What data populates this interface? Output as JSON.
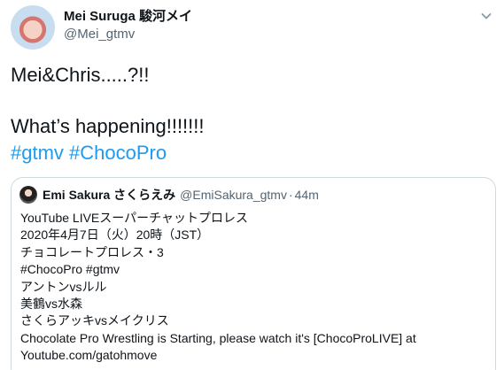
{
  "author": {
    "display_name": "Mei Suruga 駿河メイ",
    "handle": "@Mei_gtmv"
  },
  "tweet": {
    "text": "Mei&Chris.....?!!\n\nWhat’s happening!!!!!!!",
    "hashtags": [
      "#gtmv",
      "#ChocoPro"
    ]
  },
  "quote": {
    "display_name": "Emi Sakura さくらえみ",
    "handle": "@EmiSakura_gtmv",
    "separator": "·",
    "time": "44m",
    "lines": [
      "YouTube LIVEスーパーチャットプロレス",
      "2020年4月7日（火）20時（JST）",
      "チョコレートプロレス・3",
      "#ChocoPro #gtmv",
      "アントンvsルル",
      "美鶴vs水森",
      "さくらアッキvsメイクリス",
      "Chocolate Pro Wrestling is Starting, please watch it's [ChocoProLIVE] at",
      "Youtube.com/gatohmove"
    ]
  },
  "icons": {
    "menu": "chevron-down-icon"
  }
}
